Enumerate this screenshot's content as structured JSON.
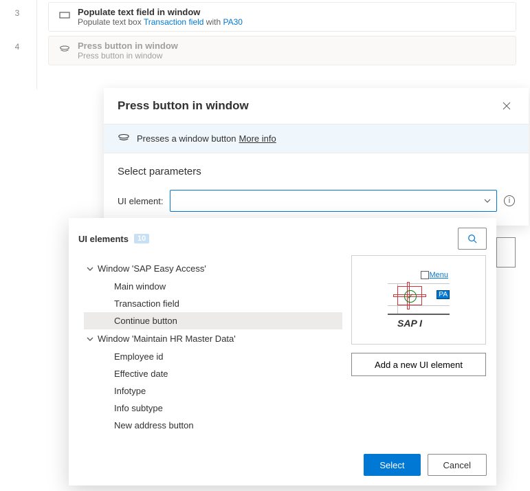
{
  "steps": [
    {
      "num": "3",
      "title": "Populate text field in window",
      "sub_pre": "Populate text box ",
      "sub_link1": "Transaction field",
      "sub_mid": " with ",
      "sub_link2": "PA30"
    },
    {
      "num": "4",
      "title": "Press button in window",
      "sub": "Press button in window"
    }
  ],
  "dialog": {
    "title": "Press button in window",
    "info_text": "Presses a window button",
    "more_info": "More info",
    "section": "Select parameters",
    "param_label": "UI element:"
  },
  "picker": {
    "title": "UI elements",
    "count": "10",
    "groups": [
      {
        "label": "Window 'SAP Easy Access'",
        "items": [
          "Main window",
          "Transaction field",
          "Continue button"
        ]
      },
      {
        "label": "Window 'Maintain HR Master Data'",
        "items": [
          "Employee id",
          "Effective date",
          "Infotype",
          "Info subtype",
          "New address button"
        ]
      }
    ],
    "selected": "Continue button",
    "preview_menu": "Menu",
    "preview_pa": "PA",
    "preview_sap": "SAP I",
    "add_label": "Add a new UI element",
    "select": "Select",
    "cancel": "Cancel"
  }
}
